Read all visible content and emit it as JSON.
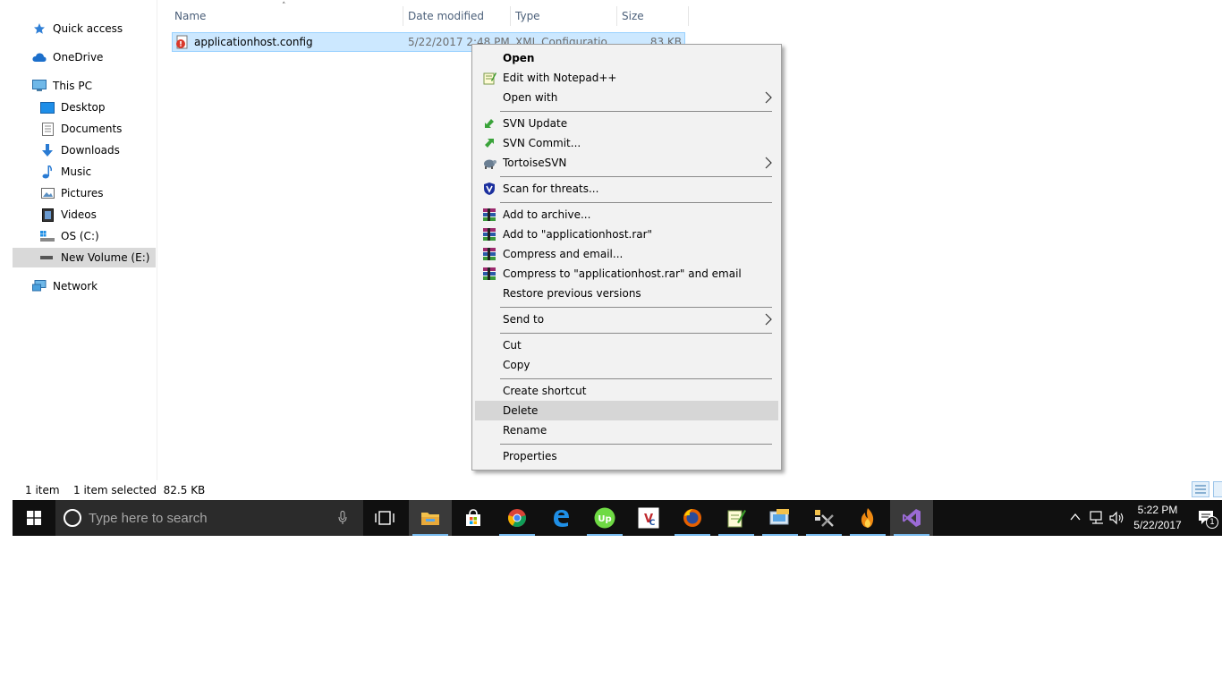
{
  "nav": {
    "items": [
      {
        "label": "Quick access",
        "icon": "star-icon"
      },
      {
        "label": "OneDrive",
        "icon": "cloud-icon"
      },
      {
        "label": "This PC",
        "icon": "computer-icon"
      },
      {
        "label": "Desktop",
        "icon": "desktop-icon"
      },
      {
        "label": "Documents",
        "icon": "documents-icon"
      },
      {
        "label": "Downloads",
        "icon": "download-icon"
      },
      {
        "label": "Music",
        "icon": "music-icon"
      },
      {
        "label": "Pictures",
        "icon": "pictures-icon"
      },
      {
        "label": "Videos",
        "icon": "videos-icon"
      },
      {
        "label": "OS (C:)",
        "icon": "drive-c-icon"
      },
      {
        "label": "New Volume (E:)",
        "icon": "drive-icon"
      },
      {
        "label": "Network",
        "icon": "network-icon"
      }
    ],
    "selected": "New Volume (E:)"
  },
  "file_list": {
    "columns": [
      "Name",
      "Date modified",
      "Type",
      "Size"
    ],
    "sort_column": "Name",
    "rows": [
      {
        "name": "applicationhost.config",
        "date": "5/22/2017 2:48 PM",
        "type": "XML Configuratio...",
        "size": "83 KB",
        "icon": "config-file-icon"
      }
    ]
  },
  "context_menu": {
    "items": {
      "open": "Open",
      "edit_notepad": "Edit with Notepad++",
      "open_with": "Open with",
      "svn_update": "SVN Update",
      "svn_commit": "SVN Commit...",
      "tortoise": "TortoiseSVN",
      "scan": "Scan for threats...",
      "add_archive": "Add to archive...",
      "add_rar": "Add to \"applicationhost.rar\"",
      "compress_email": "Compress and email...",
      "compress_rar_email": "Compress to \"applicationhost.rar\" and email",
      "restore": "Restore previous versions",
      "send_to": "Send to",
      "cut": "Cut",
      "copy": "Copy",
      "create_shortcut": "Create shortcut",
      "delete": "Delete",
      "rename": "Rename",
      "properties": "Properties"
    },
    "highlighted": "Delete"
  },
  "status": {
    "item_count": "1 item",
    "selection": "1 item selected  82.5 KB"
  },
  "taskbar": {
    "search_placeholder": "Type here to search",
    "time": "5:22 PM",
    "date": "5/22/2017",
    "notification_count": "1"
  },
  "colors": {
    "selection_bg": "#cce8ff",
    "selection_border": "#99d1ff",
    "menu_bg": "#f2f2f2",
    "taskbar_bg": "#101010",
    "accent": "#76b9ed"
  }
}
